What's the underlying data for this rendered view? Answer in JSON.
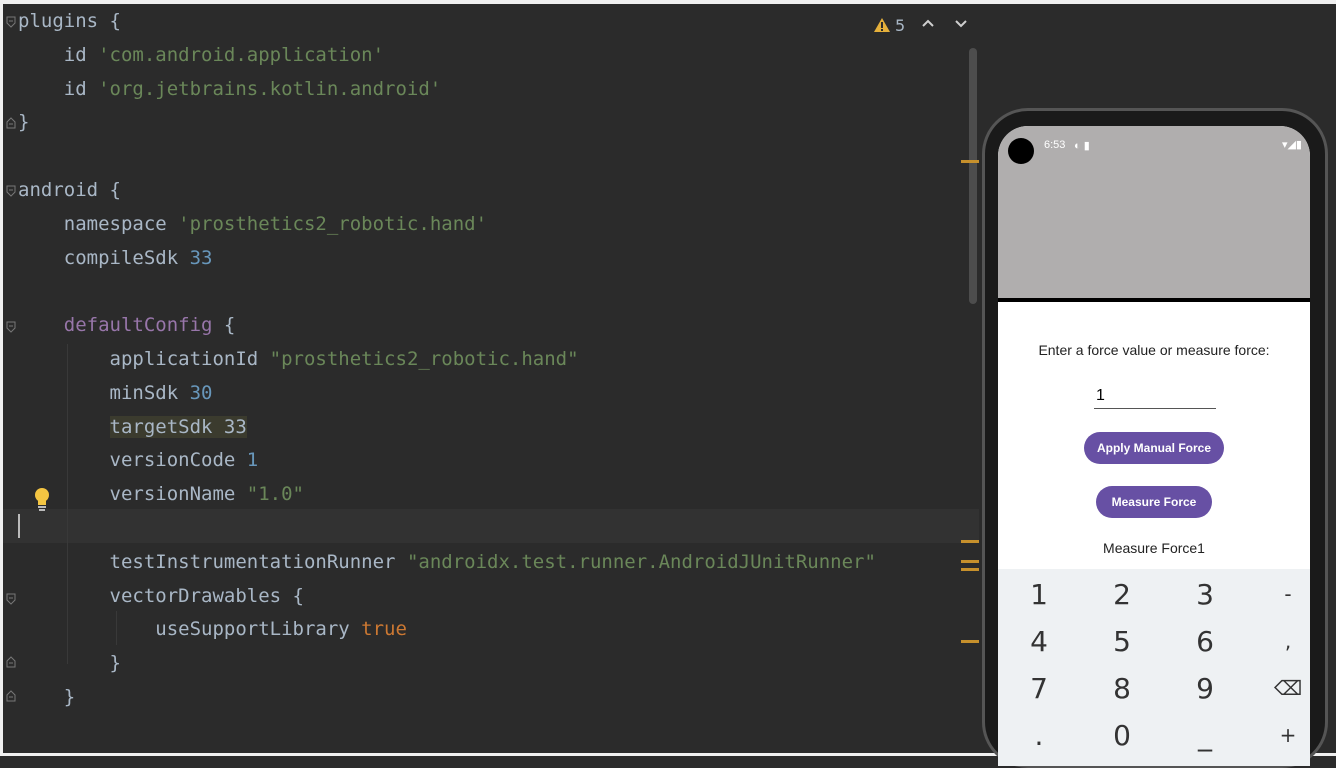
{
  "editor": {
    "lines": [
      {
        "id": "l1",
        "parts": [
          {
            "t": "plugins ",
            "c": "id"
          },
          {
            "t": "{",
            "c": "id"
          }
        ]
      },
      {
        "id": "l2",
        "parts": [
          {
            "t": "    id ",
            "c": "id"
          },
          {
            "t": "'com.android.application'",
            "c": "str"
          }
        ]
      },
      {
        "id": "l3",
        "parts": [
          {
            "t": "    id ",
            "c": "id"
          },
          {
            "t": "'org.jetbrains.kotlin.android'",
            "c": "str"
          }
        ]
      },
      {
        "id": "l4",
        "parts": [
          {
            "t": "}",
            "c": "id"
          }
        ]
      },
      {
        "id": "l5",
        "parts": []
      },
      {
        "id": "l6",
        "parts": [
          {
            "t": "android ",
            "c": "id"
          },
          {
            "t": "{",
            "c": "id"
          }
        ]
      },
      {
        "id": "l7",
        "parts": [
          {
            "t": "    namespace ",
            "c": "id"
          },
          {
            "t": "'prosthetics2_robotic.hand'",
            "c": "str"
          }
        ]
      },
      {
        "id": "l8",
        "parts": [
          {
            "t": "    compileSdk ",
            "c": "id"
          },
          {
            "t": "33",
            "c": "num"
          }
        ]
      },
      {
        "id": "l9",
        "parts": []
      },
      {
        "id": "l10",
        "parts": [
          {
            "t": "    ",
            "c": "id"
          },
          {
            "t": "defaultConfig",
            "c": "fn"
          },
          {
            "t": " {",
            "c": "id"
          }
        ]
      },
      {
        "id": "l11",
        "parts": [
          {
            "t": "        applicationId ",
            "c": "id"
          },
          {
            "t": "\"prosthetics2_robotic.hand\"",
            "c": "str"
          }
        ]
      },
      {
        "id": "l12",
        "parts": [
          {
            "t": "        minSdk ",
            "c": "id"
          },
          {
            "t": "30",
            "c": "num"
          }
        ]
      },
      {
        "id": "l13",
        "parts": [
          {
            "t": "        ",
            "c": "id"
          },
          {
            "t": "targetSdk 33",
            "c": "hl"
          }
        ]
      },
      {
        "id": "l14",
        "parts": [
          {
            "t": "        versionCode ",
            "c": "id"
          },
          {
            "t": "1",
            "c": "num"
          }
        ]
      },
      {
        "id": "l15",
        "parts": [
          {
            "t": "        versionName ",
            "c": "id"
          },
          {
            "t": "\"1.0\"",
            "c": "str"
          }
        ]
      },
      {
        "id": "l16",
        "parts": []
      },
      {
        "id": "l17",
        "parts": [
          {
            "t": "        testInstrumentationRunner ",
            "c": "id"
          },
          {
            "t": "\"androidx.test.runner.AndroidJUnitRunner\"",
            "c": "str"
          }
        ]
      },
      {
        "id": "l18",
        "parts": [
          {
            "t": "        vectorDrawables {",
            "c": "id"
          }
        ]
      },
      {
        "id": "l19",
        "parts": [
          {
            "t": "            useSupportLibrary ",
            "c": "id"
          },
          {
            "t": "true",
            "c": "kw"
          }
        ]
      },
      {
        "id": "l20",
        "parts": [
          {
            "t": "        }",
            "c": "id"
          }
        ]
      },
      {
        "id": "l21",
        "parts": [
          {
            "t": "    }",
            "c": "id"
          }
        ]
      }
    ],
    "warning_count": "5",
    "icons": {
      "warning": "warning-icon",
      "up": "chevron-up-icon",
      "down": "chevron-down-icon",
      "bulb": "lightbulb-icon"
    },
    "colors": {
      "background": "#2b2b2b",
      "text": "#a9b7c6",
      "string": "#6a8759",
      "number": "#6897bb",
      "keyword": "#cc7832",
      "method": "#9876aa",
      "marker": "#c6902c"
    }
  },
  "emulator": {
    "status_time": "6:53",
    "status_icons": "▾◢▮",
    "prompt": "Enter a force value or measure force:",
    "input_value": "1",
    "apply_button": "Apply Manual Force",
    "measure_button": "Measure Force",
    "result_text": "Measure Force1",
    "keys": [
      "1",
      "2",
      "3",
      "-",
      "4",
      "5",
      "6",
      ",",
      "7",
      "8",
      "9",
      "⌫",
      ".",
      "0",
      "_",
      "+"
    ],
    "accent": "#6750a4"
  }
}
